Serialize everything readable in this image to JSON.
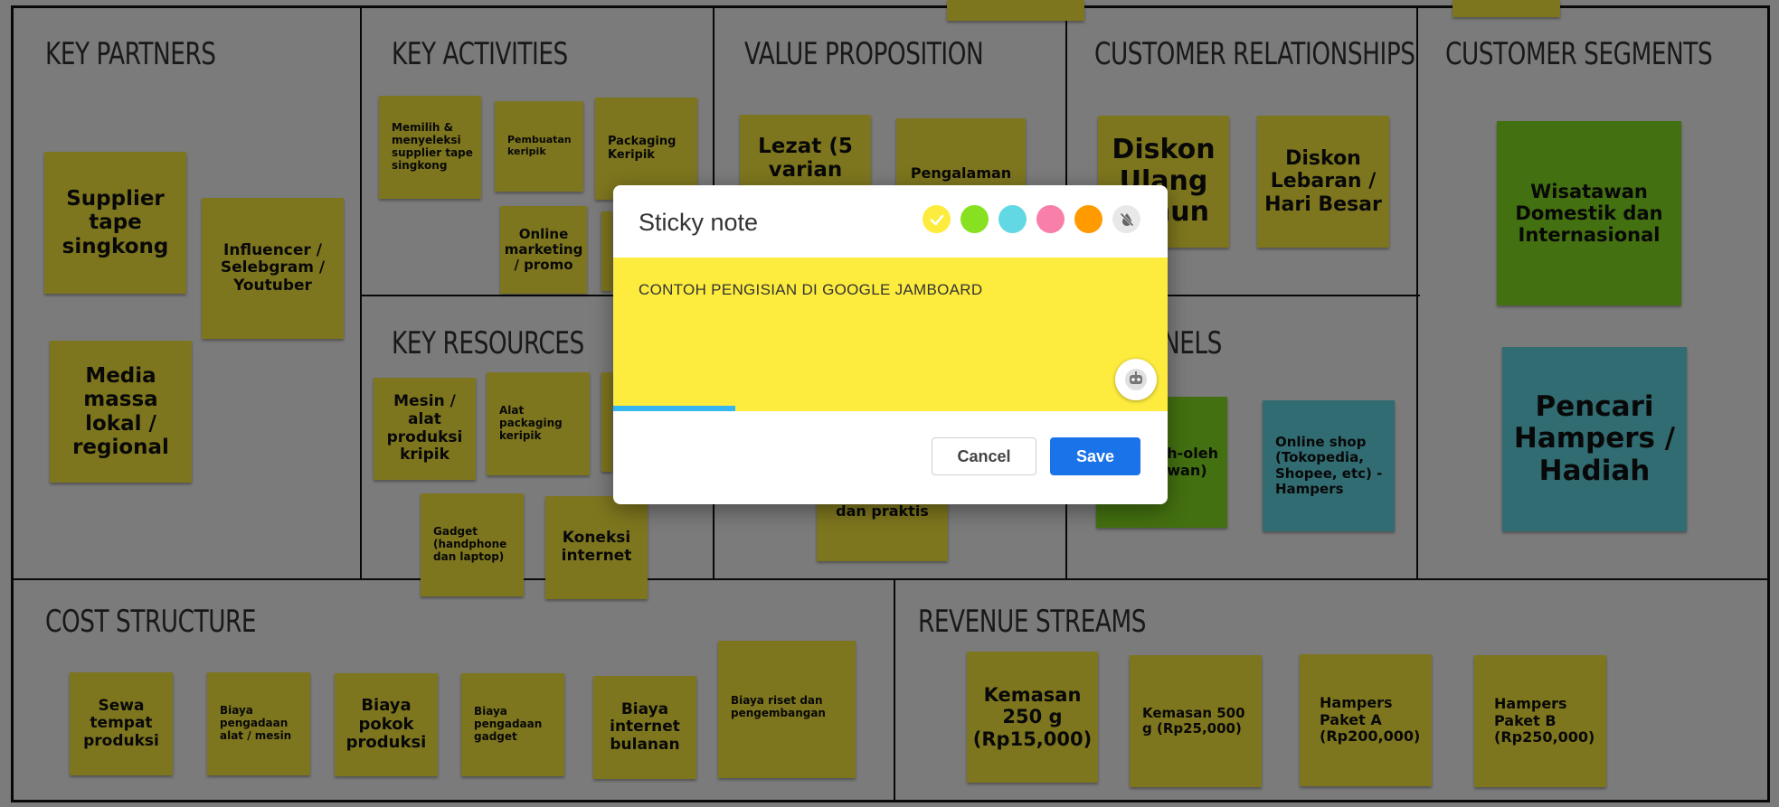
{
  "board": {
    "sections": {
      "key_partners": "KEY PARTNERS",
      "key_activities": "KEY ACTIVITIES",
      "value_proposition": "VALUE PROPOSITION",
      "customer_relationships": "CUSTOMER RELATIONSHIPS",
      "customer_segments": "CUSTOMER SEGMENTS",
      "key_resources": "KEY RESOURCES",
      "channels": "NELS",
      "cost_structure": "COST STRUCTURE",
      "revenue_streams": "REVENUE STREAMS"
    },
    "notes": {
      "partner_supplier": [
        "Supplier",
        "tape",
        "singkong"
      ],
      "partner_influencer": [
        "Influencer /",
        "Selebgram /",
        "Youtuber"
      ],
      "partner_media": [
        "Media",
        "massa",
        "lokal /",
        "regional"
      ],
      "activity_select_supplier": [
        "Memilih &",
        "menyeleksi",
        "supplier tape",
        "singkong"
      ],
      "activity_make_chips": [
        "Pembuatan",
        "keripik"
      ],
      "activity_packaging": [
        "Packaging",
        "Keripik"
      ],
      "activity_online_marketing": [
        "Online",
        "marketing",
        "/ promo"
      ],
      "value_tasty": [
        "Lezat (5",
        "varian"
      ],
      "value_experience": [
        "Pengalaman"
      ],
      "value_practical": [
        "dan praktis"
      ],
      "rel_discount_birthday": [
        "Diskon",
        "Ulang",
        "Tahun"
      ],
      "rel_discount_holiday": [
        "Diskon",
        "Lebaran /",
        "Hari Besar"
      ],
      "segment_tourists": [
        "Wisatawan",
        "Domestik dan",
        "Internasional"
      ],
      "segment_hampers": [
        "Pencari",
        "Hampers /",
        "Hadiah"
      ],
      "resource_machine": [
        "Mesin /",
        "alat",
        "produksi",
        "kripik"
      ],
      "resource_packaging_tool": [
        "Alat",
        "packaging",
        "keripik"
      ],
      "resource_gadget": [
        "Gadget",
        "(handphone",
        "dan laptop)"
      ],
      "resource_internet": [
        "Koneksi",
        "internet"
      ],
      "channel_souvenir": [
        "h-oleh",
        "wan)"
      ],
      "channel_online_shop": [
        "Online shop",
        "(Tokopedia,",
        "Shopee, etc) -",
        "Hampers"
      ],
      "cost_rent": [
        "Sewa",
        "tempat",
        "produksi"
      ],
      "cost_tools": [
        "Biaya",
        "pengadaan",
        "alat / mesin"
      ],
      "cost_cogs": [
        "Biaya",
        "pokok",
        "produksi"
      ],
      "cost_gadget": [
        "Biaya",
        "pengadaan",
        "gadget"
      ],
      "cost_internet": [
        "Biaya",
        "internet",
        "bulanan"
      ],
      "cost_research": [
        "Biaya riset dan",
        "pengembangan"
      ],
      "rev_250g": [
        "Kemasan",
        "250 g",
        "(Rp15,000)"
      ],
      "rev_500g": [
        "Kemasan 500",
        "g (Rp25,000)"
      ],
      "rev_hampers_a": [
        "Hampers",
        "Paket A",
        "(Rp200,000)"
      ],
      "rev_hampers_b": [
        "Hampers",
        "Paket B",
        "(Rp250,000)"
      ]
    }
  },
  "dialog": {
    "title": "Sticky note",
    "colors": {
      "yellow": "#fdec3d",
      "green": "#87e120",
      "teal": "#62d8e4",
      "pink": "#f87faa",
      "orange": "#ff9a00",
      "transparent": "#e8e8e8",
      "selected": "yellow"
    },
    "note_text": "CONTOH PENGISIAN DI GOOGLE JAMBOARD",
    "progress_fraction": 0.22,
    "cancel_label": "Cancel",
    "save_label": "Save"
  }
}
